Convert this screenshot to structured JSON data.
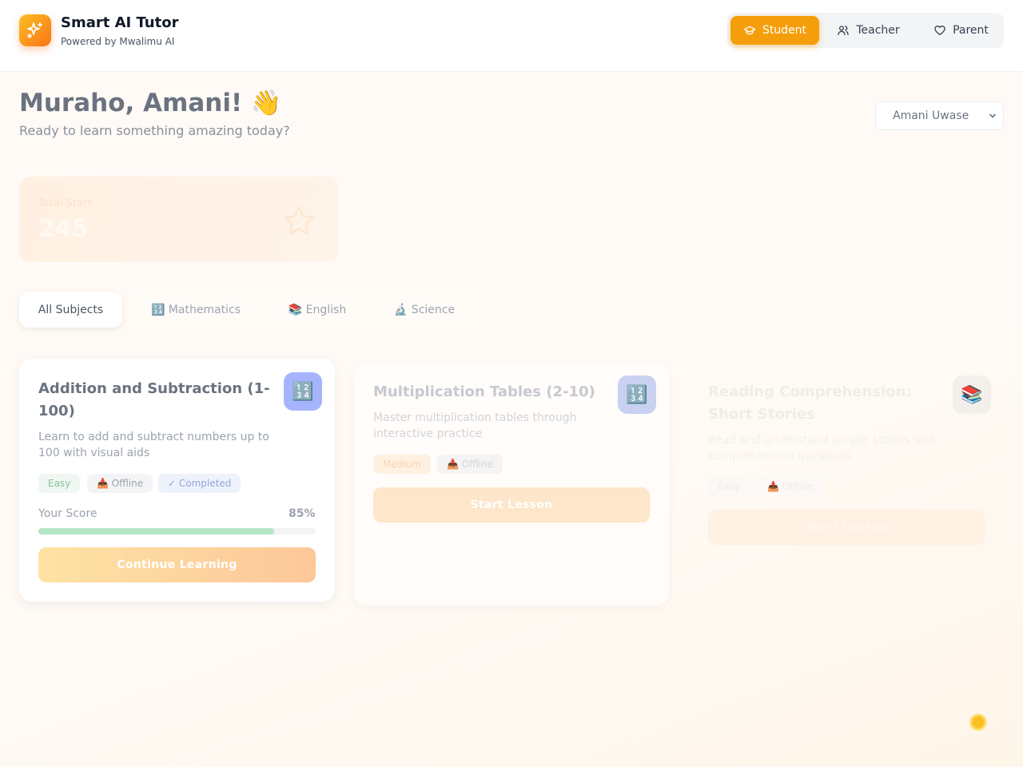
{
  "app": {
    "title": "Smart AI Tutor",
    "subtitle": "Powered by Mwalimu AI",
    "logo_icon": "sparkles-icon"
  },
  "roles": [
    {
      "label": "Student",
      "icon": "graduation-cap-icon",
      "active": true
    },
    {
      "label": "Teacher",
      "icon": "users-icon",
      "active": false
    },
    {
      "label": "Parent",
      "icon": "heart-icon",
      "active": false
    }
  ],
  "greeting": {
    "title": "Muraho, Amani! 👋",
    "subtitle": "Ready to learn something amazing today?"
  },
  "student_select": {
    "value": "Amani Uwase"
  },
  "stats": {
    "label": "Total Stars",
    "value": "245",
    "icon": "star-icon"
  },
  "filters": [
    {
      "label": "All Subjects",
      "active": true
    },
    {
      "label": "🔢 Mathematics",
      "active": false
    },
    {
      "label": "📚 English",
      "active": false
    },
    {
      "label": "🔬 Science",
      "active": false
    }
  ],
  "lessons": [
    {
      "title": "Addition and Subtraction (1-100)",
      "description": "Learn to add and subtract numbers up to 100 with visual aids",
      "icon": "🔢",
      "badges": [
        "Easy",
        "📥 Offline",
        "✓ Completed"
      ],
      "score_label": "Your Score",
      "score": "85%",
      "progress": 0.85,
      "cta": "Continue Learning"
    },
    {
      "title": "Multiplication Tables (2-10)",
      "description": "Master multiplication tables through interactive practice",
      "icon": "🔢",
      "badges": [
        "Medium",
        "📥 Offline"
      ],
      "cta": "Start Lesson"
    },
    {
      "title": "Reading Comprehension: Short Stories",
      "description": "Read and understand simple stories with comprehension questions",
      "icon": "📚",
      "badges": [
        "Easy",
        "📥 Offline"
      ],
      "cta": "Start Lesson"
    }
  ],
  "colors": {
    "accent": "#f59e0b",
    "accent_dark": "#f97316",
    "success": "#22c55e",
    "text_dark": "#111827"
  }
}
